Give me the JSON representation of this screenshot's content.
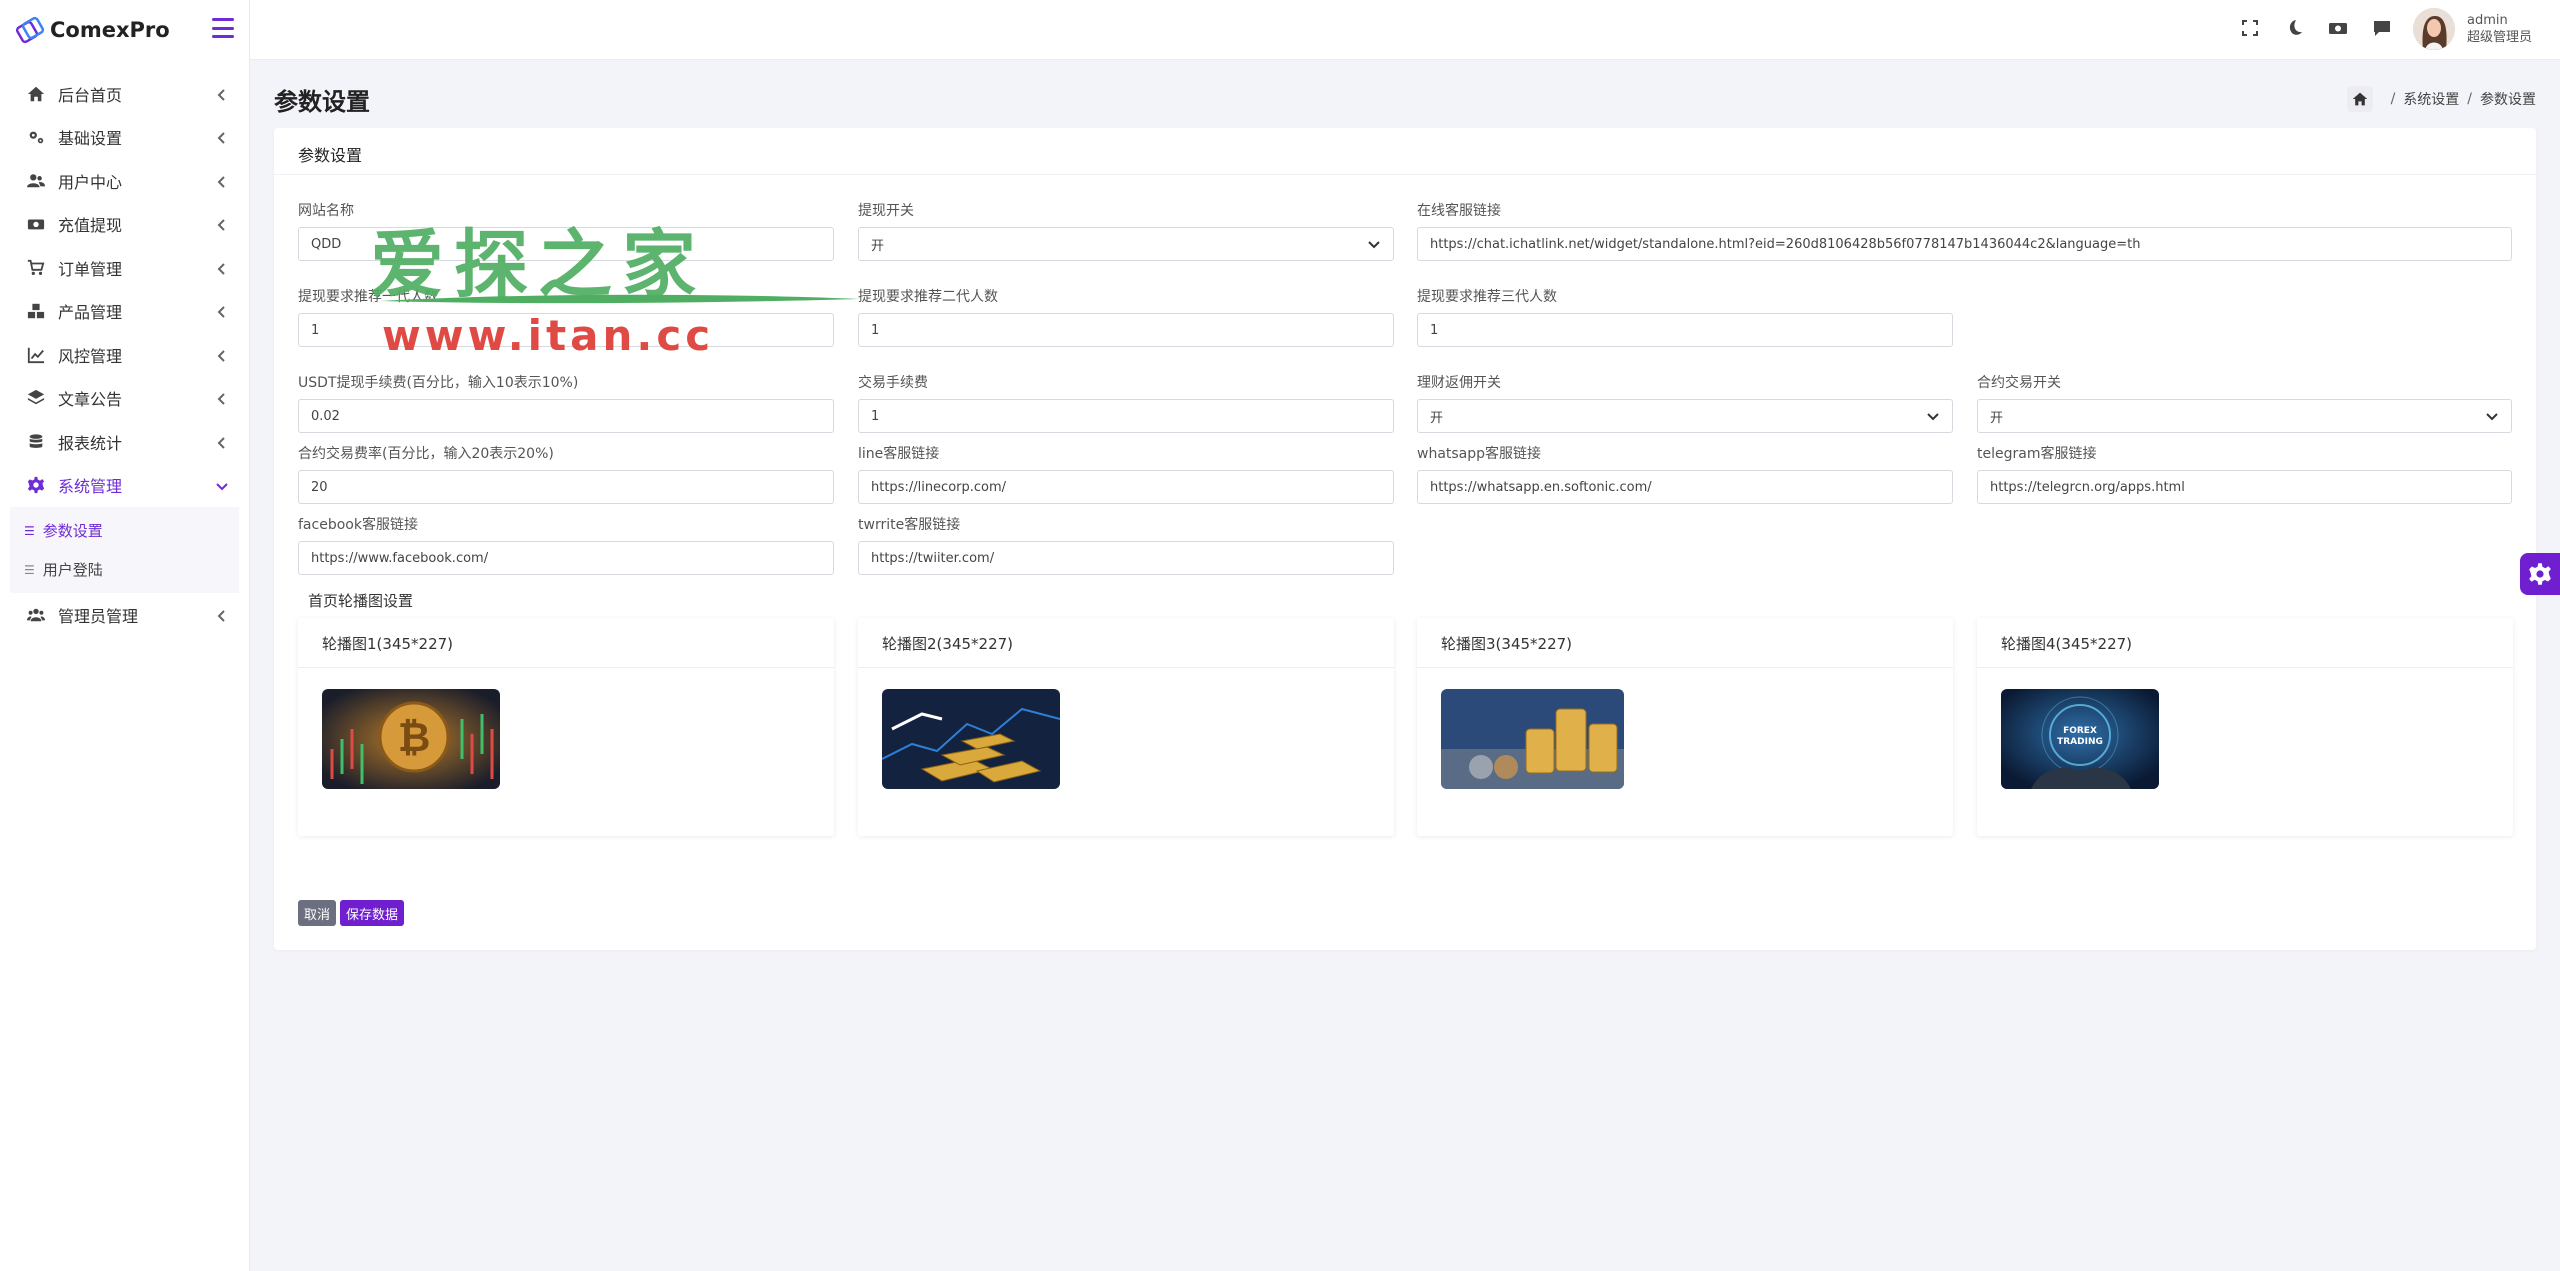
{
  "brand": {
    "name": "ComexPro"
  },
  "sidebar": {
    "items": [
      {
        "label": "后台首页",
        "icon": "home-icon"
      },
      {
        "label": "基础设置",
        "icon": "gears-icon"
      },
      {
        "label": "用户中心",
        "icon": "users-icon"
      },
      {
        "label": "充值提现",
        "icon": "money-icon"
      },
      {
        "label": "订单管理",
        "icon": "cart-icon"
      },
      {
        "label": "产品管理",
        "icon": "boxes-icon"
      },
      {
        "label": "风控管理",
        "icon": "chart-line-icon"
      },
      {
        "label": "文章公告",
        "icon": "layers-icon"
      },
      {
        "label": "报表统计",
        "icon": "database-icon"
      },
      {
        "label": "系统管理",
        "icon": "gear-icon"
      },
      {
        "label": "管理员管理",
        "icon": "user-group-icon"
      }
    ],
    "sub_items": [
      {
        "label": "参数设置"
      },
      {
        "label": "用户登陆"
      }
    ]
  },
  "user": {
    "name": "admin",
    "role": "超级管理员"
  },
  "page": {
    "title": "参数设置"
  },
  "breadcrumb": {
    "level1": "系统设置",
    "level2": "参数设置"
  },
  "card": {
    "title": "参数设置"
  },
  "form": {
    "site_name": {
      "label": "网站名称",
      "value": "QDD"
    },
    "withdraw_switch": {
      "label": "提现开关",
      "value": "开"
    },
    "online_service": {
      "label": "在线客服链接",
      "value": "https://chat.ichatlink.net/widget/standalone.html?eid=260d8106428b56f0778147b1436044c2&language=th"
    },
    "ref_level1": {
      "label": "提现要求推荐一代人数",
      "value": "1"
    },
    "ref_level2": {
      "label": "提现要求推荐二代人数",
      "value": "1"
    },
    "ref_level3": {
      "label": "提现要求推荐三代人数",
      "value": "1"
    },
    "usdt_fee": {
      "label": "USDT提现手续费(百分比，输入10表示10%)",
      "value": "0.02"
    },
    "trade_fee": {
      "label": "交易手续费",
      "value": "1"
    },
    "finance_rebate": {
      "label": "理财返佣开关",
      "value": "开"
    },
    "contract_switch": {
      "label": "合约交易开关",
      "value": "开"
    },
    "contract_fee": {
      "label": "合约交易费率(百分比，输入20表示20%)",
      "value": "20"
    },
    "line_link": {
      "label": "line客服链接",
      "value": "https://linecorp.com/"
    },
    "whatsapp_link": {
      "label": "whatsapp客服链接",
      "value": "https://whatsapp.en.softonic.com/"
    },
    "telegram_link": {
      "label": "telegram客服链接",
      "value": "https://telegrcn.org/apps.html"
    },
    "facebook_link": {
      "label": "facebook客服链接",
      "value": "https://www.facebook.com/"
    },
    "twitter_link": {
      "label": "twrrite客服链接",
      "value": "https://twiiter.com/"
    }
  },
  "banners": {
    "section_label": "首页轮播图设置",
    "items": [
      {
        "title": "轮播图1(345*227)"
      },
      {
        "title": "轮播图2(345*227)"
      },
      {
        "title": "轮播图3(345*227)"
      },
      {
        "title": "轮播图4(345*227)",
        "image_text": "FOREX TRADING"
      }
    ]
  },
  "actions": {
    "cancel": "取消",
    "save": "保存数据"
  },
  "watermark": {
    "cn": "爱探之家",
    "url": "www.itan.cc"
  },
  "colors": {
    "accent": "#6f1fd0",
    "sidebar_bg": "#ffffff",
    "page_bg": "#f3f3fa"
  }
}
